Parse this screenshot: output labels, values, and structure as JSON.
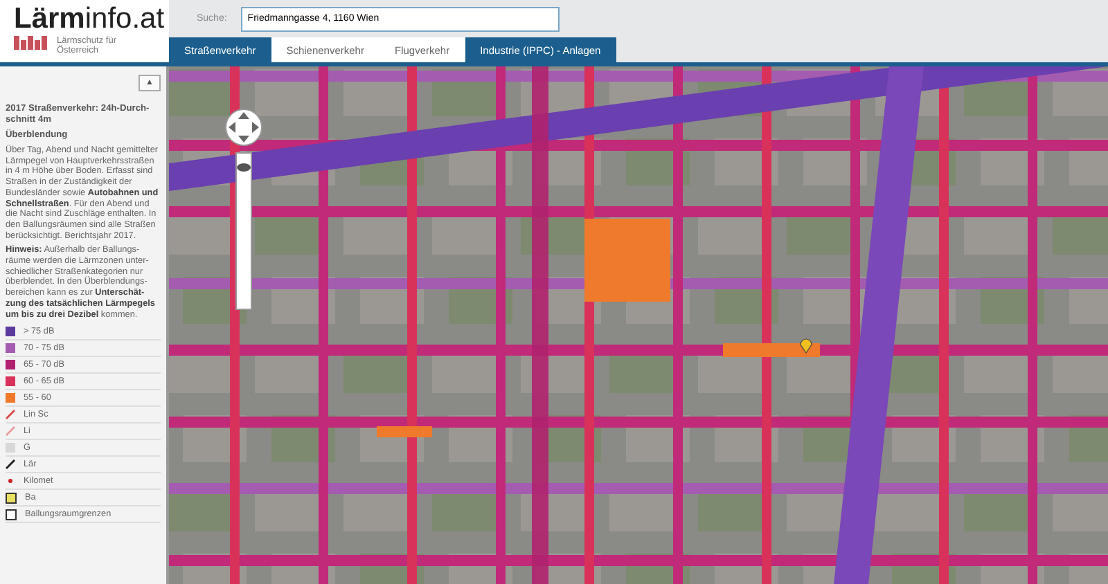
{
  "logo": {
    "name_bold": "Lärm",
    "name_rest": "info.at",
    "tagline": "Lärmschutz für Österreich"
  },
  "map": {
    "zoom": {
      "level": 0.93
    }
  },
  "search": {
    "label": "Suche:",
    "value": "Friedmanngasse 4, 1160 Wien"
  },
  "tabs": [
    {
      "label": "Straßenverkehr",
      "selected": true
    },
    {
      "label": "Schienenverkehr",
      "selected": false
    },
    {
      "label": "Flugverkehr",
      "selected": false
    },
    {
      "label": "Industrie (IPPC) - Anlagen",
      "selected": true
    }
  ],
  "sidebar": {
    "collapse_button": "▲",
    "title": "2017 Straßenverkehr: 24h-Durch-schnitt 4m",
    "subtitle": "Überblendung",
    "paragraphs": [
      "Über Tag, Abend und Nacht gemittelter Lärmpegel von Hauptverkehrsstraßen in 4 m Höhe über Boden. Erfasst sind Straßen in der Zuständigkeit der Bundesländer sowie **Autobahnen und Schnellstraßen**. Für den Abend und die Nacht sind Zuschläge enthalten. In den Ballungsräumen sind alle Straßen berücksichtigt. Berichtsjahr 2017.",
      "**Hinweis:** Außerhalb der Ballungs-räume werden die Lärmzonen unter-schiedlicher Straßenkategorien nur überblendet. In den Überblendungs-bereichen kann es zur **Unterschät-zung des tatsächlichen Lärmpegels um bis zu drei Dezibel** kommen."
    ],
    "legend": [
      {
        "kind": "swatch",
        "color": "#5b3a9e",
        "label": "> 75 dB"
      },
      {
        "kind": "swatch",
        "color": "#a45cb0",
        "label": "70 - 75 dB"
      },
      {
        "kind": "swatch",
        "color": "#b0226e",
        "label": "65 - 70 dB"
      },
      {
        "kind": "swatch",
        "color": "#d8325a",
        "label": "60 - 65 dB"
      },
      {
        "kind": "swatch",
        "color": "#ef7a2c",
        "label": "55 - 60"
      },
      {
        "kind": "line",
        "color": "#d84a4a",
        "label": "Lin Sc"
      },
      {
        "kind": "line",
        "color": "#e8a0a0",
        "label": "Li"
      },
      {
        "kind": "swatch",
        "color": "#d8d8d8",
        "label": "G"
      },
      {
        "kind": "line",
        "color": "#222222",
        "label": "Lär"
      },
      {
        "kind": "dot",
        "color": "#cc2222",
        "label": "Kilomet"
      },
      {
        "kind": "outline",
        "color": "#e8e060",
        "label": "Ba"
      },
      {
        "kind": "outline",
        "color": "#ffffff",
        "label": "Ballungsraumgrenzen"
      }
    ]
  }
}
